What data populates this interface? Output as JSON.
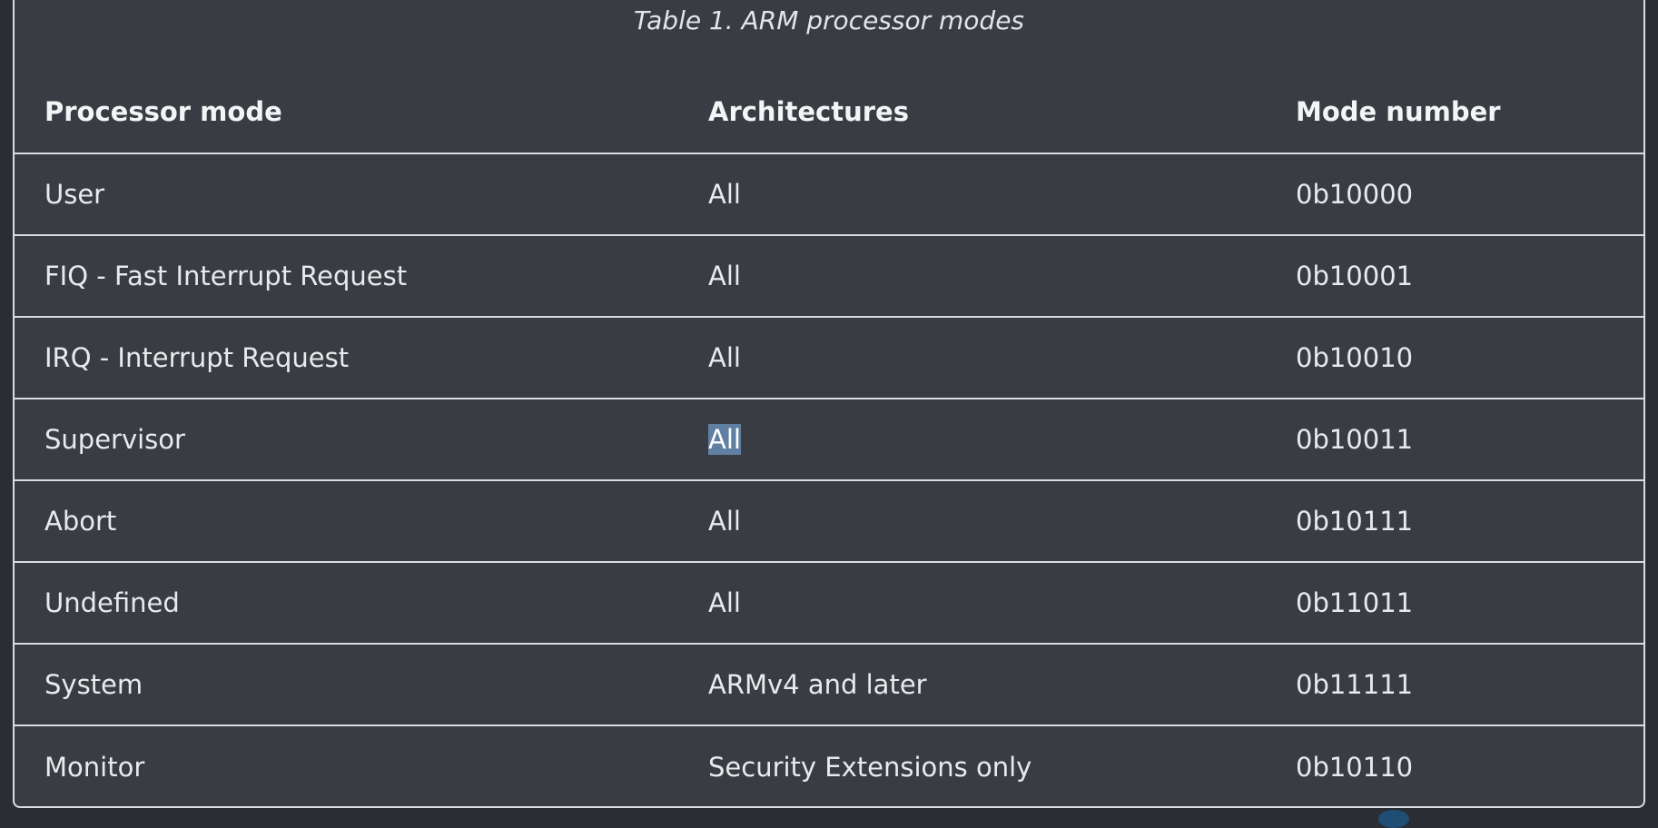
{
  "caption": "Table 1. ARM processor modes",
  "table": {
    "headers": [
      "Processor mode",
      "Architectures",
      "Mode number"
    ],
    "rows": [
      {
        "mode": "User",
        "arch": "All",
        "number": "0b10000"
      },
      {
        "mode": "FIQ - Fast Interrupt Request",
        "arch": "All",
        "number": "0b10001"
      },
      {
        "mode": "IRQ - Interrupt Request",
        "arch": "All",
        "number": "0b10010"
      },
      {
        "mode": "Supervisor",
        "arch": "All",
        "number": "0b10011"
      },
      {
        "mode": "Abort",
        "arch": "All",
        "number": "0b10111"
      },
      {
        "mode": "Undefined",
        "arch": "All",
        "number": "0b11011"
      },
      {
        "mode": "System",
        "arch": "ARMv4 and later",
        "number": "0b11111"
      },
      {
        "mode": "Monitor",
        "arch": "Security Extensions only",
        "number": "0b10110"
      }
    ],
    "selected_cell": {
      "row": 3,
      "column": "arch"
    }
  },
  "colors": {
    "page_background": "#2a2d33",
    "table_background": "#393c42",
    "border": "#dcdde0",
    "text": "#e9eaec",
    "selection_highlight": "#5f7fa3"
  }
}
